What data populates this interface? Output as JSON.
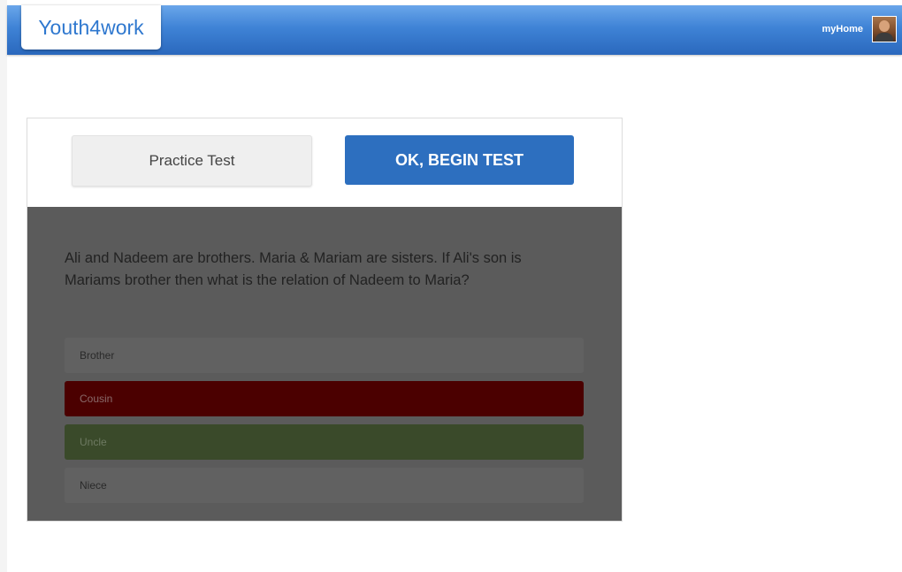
{
  "app": {
    "logo_text": "Youth4work",
    "nav": {
      "myhome_label": "myHome"
    }
  },
  "test": {
    "practice_label": "Practice Test",
    "begin_label": "OK, BEGIN TEST",
    "question": "Ali and Nadeem are brothers. Maria & Mariam are sisters. If Ali's son is Mariams brother then what is the relation of Nadeem to Maria?",
    "options": [
      {
        "label": "Brother",
        "state": "neutral",
        "color": "#616161"
      },
      {
        "label": "Cousin",
        "state": "incorrect",
        "color": "#4b0000"
      },
      {
        "label": "Uncle",
        "state": "correct",
        "color": "#3a4a2a"
      },
      {
        "label": "Niece",
        "state": "neutral",
        "color": "#616161"
      }
    ]
  },
  "colors": {
    "navbar": "#3f83d6",
    "primary_button": "#2d6fbf",
    "overlay": "#5b5b5b"
  },
  "icons": {
    "avatar": "user-avatar"
  }
}
